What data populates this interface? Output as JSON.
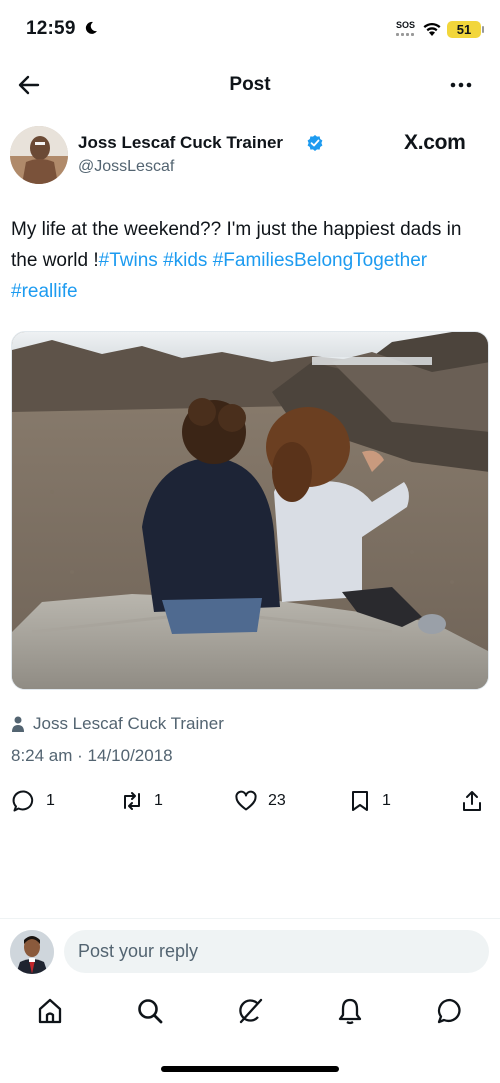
{
  "status_bar": {
    "time": "12:59",
    "sos": "SOS",
    "battery": "51",
    "battery_color": "#f2d63b"
  },
  "header": {
    "title": "Post",
    "back_icon": "arrow-left-icon",
    "more_icon": "more-horizontal-icon"
  },
  "post": {
    "author_name": "Joss Lescaf Cuck Trainer",
    "author_handle": "@JossLescaf",
    "verified": true,
    "verified_color": "#1d9bf0",
    "source_label": "X.com",
    "text_plain": "My life at the weekend?? I'm just the happiest dads in the world !",
    "hashtags": [
      "#Twins",
      "#kids",
      "#FamiliesBelongTogether",
      "#reallife"
    ],
    "attribution": "Joss Lescaf Cuck Trainer",
    "timestamp": "8:24 am · 14/10/2018",
    "link_color": "#1d9bf0"
  },
  "actions": [
    {
      "name": "reply",
      "icon": "comment-icon",
      "count": "1"
    },
    {
      "name": "repost",
      "icon": "repost-icon",
      "count": "1"
    },
    {
      "name": "like",
      "icon": "heart-icon",
      "count": "23"
    },
    {
      "name": "bookmark",
      "icon": "bookmark-icon",
      "count": "1"
    },
    {
      "name": "share",
      "icon": "share-icon",
      "count": ""
    }
  ],
  "reply_bar": {
    "placeholder": "Post your reply"
  },
  "nav": [
    {
      "name": "home",
      "icon": "home-icon"
    },
    {
      "name": "search",
      "icon": "search-icon"
    },
    {
      "name": "grok",
      "icon": "grok-icon"
    },
    {
      "name": "notifications",
      "icon": "bell-icon"
    },
    {
      "name": "messages",
      "icon": "message-icon"
    }
  ]
}
